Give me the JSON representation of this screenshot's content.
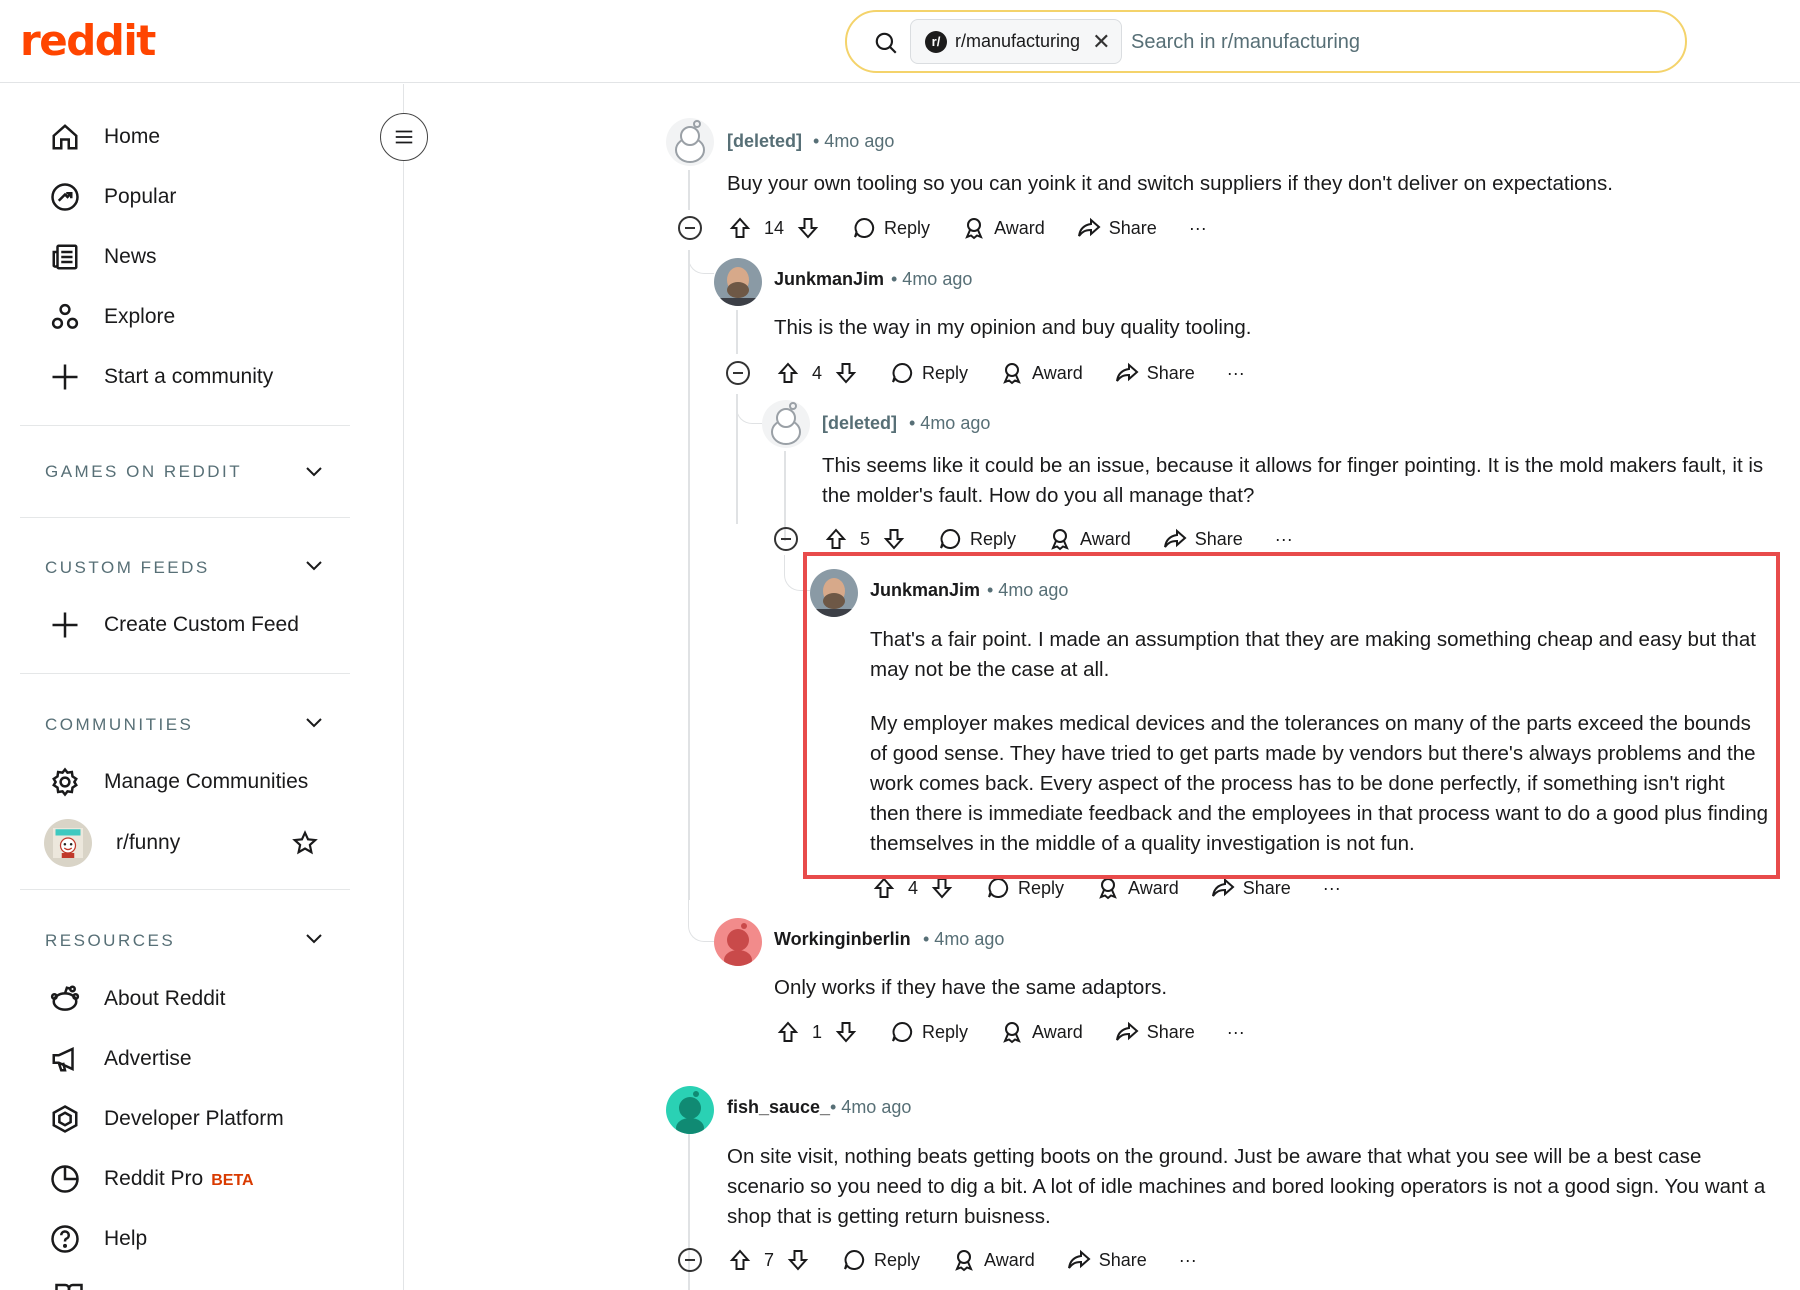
{
  "header": {
    "logo": "reddit",
    "search_chip": "r/manufacturing",
    "search_chip_icon": "r/",
    "search_placeholder": "Search in r/manufacturing"
  },
  "sidebar": {
    "nav": [
      {
        "label": "Home",
        "icon": "home-icon"
      },
      {
        "label": "Popular",
        "icon": "popular-icon"
      },
      {
        "label": "News",
        "icon": "news-icon"
      },
      {
        "label": "Explore",
        "icon": "explore-icon"
      },
      {
        "label": "Start a community",
        "icon": "plus-icon"
      }
    ],
    "sections": {
      "games": "GAMES ON REDDIT",
      "custom_feeds": "CUSTOM FEEDS",
      "create_custom_feed": "Create Custom Feed",
      "communities": "COMMUNITIES",
      "manage_communities": "Manage Communities",
      "community_funny": "r/funny",
      "resources": "RESOURCES"
    },
    "resources": [
      {
        "label": "About Reddit",
        "icon": "reddit-alien-icon"
      },
      {
        "label": "Advertise",
        "icon": "megaphone-icon"
      },
      {
        "label": "Developer Platform",
        "icon": "hexagon-icon"
      },
      {
        "label": "Reddit Pro",
        "icon": "pie-chart-icon",
        "badge": "BETA"
      },
      {
        "label": "Help",
        "icon": "help-icon"
      }
    ]
  },
  "actions": {
    "reply": "Reply",
    "award": "Award",
    "share": "Share",
    "more": "···"
  },
  "comments": [
    {
      "author": "[deleted]",
      "time": "• 4mo ago",
      "body": [
        "Buy your own tooling so you can yoink it and switch suppliers if they don't deliver on expectations."
      ],
      "votes": "14"
    },
    {
      "author": "JunkmanJim",
      "time": "• 4mo ago",
      "body": [
        "This is the way in my opinion and buy quality tooling."
      ],
      "votes": "4"
    },
    {
      "author": "[deleted]",
      "time": "• 4mo ago",
      "body": [
        "This seems like it could be an issue, because it allows for finger pointing. It is the mold makers fault, it is the molder's fault. How do you all manage that?"
      ],
      "votes": "5"
    },
    {
      "author": "JunkmanJim",
      "time": "• 4mo ago",
      "body": [
        "That's a fair point. I made an assumption that they are making something cheap and easy but that may not be the case at all.",
        "My employer makes medical devices and the tolerances on many of the parts exceed the bounds of good sense. They have tried to get parts made by vendors but there's always problems and the work comes back. Every aspect of the process has to be done perfectly, if something isn't right then there is immediate feedback and the employees in that process want to do a good plus finding themselves in the middle of a quality investigation is not fun."
      ],
      "votes": "4"
    },
    {
      "author": "Workinginberlin",
      "time": "• 4mo ago",
      "body": [
        "Only works if they have the same adaptors."
      ],
      "votes": "1"
    },
    {
      "author": "fish_sauce_",
      "time": "• 4mo ago",
      "body": [
        "On site visit, nothing beats getting boots on the ground. Just be aware that what you see will be a best case scenario so you need to dig a bit. A lot of idle machines and bored looking operators is not a good sign. You want a shop that is getting return buisness."
      ],
      "votes": "7"
    }
  ],
  "colors": {
    "brand": "#ff4500",
    "highlight": "#e84b4b",
    "search_border": "#f4d36b",
    "meta": "#576f76",
    "beta": "#d93a00"
  }
}
